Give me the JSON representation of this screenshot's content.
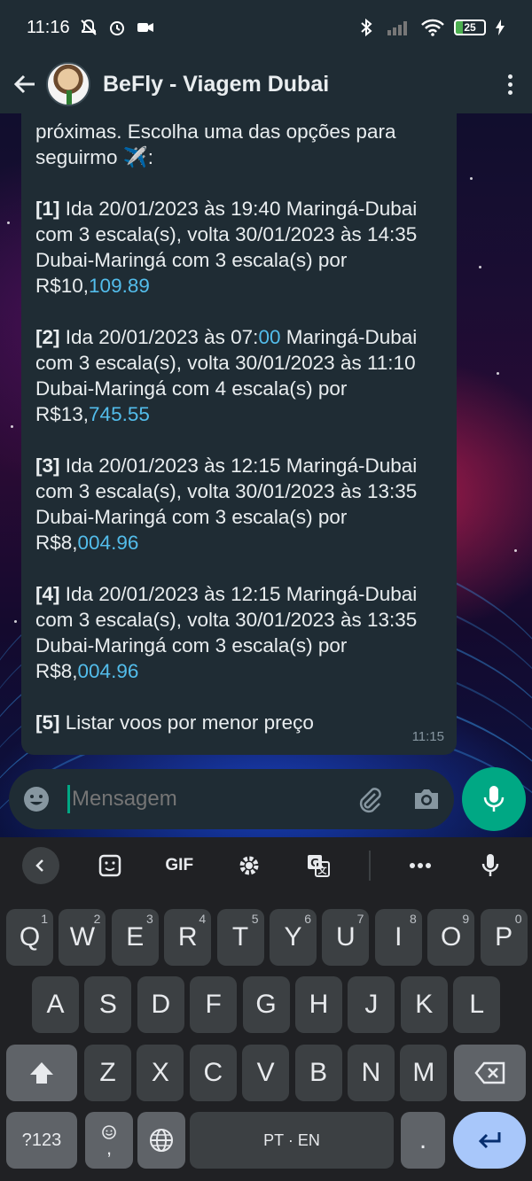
{
  "status_bar": {
    "time": "11:16",
    "battery": "25"
  },
  "header": {
    "title": "BeFly - Viagem Dubai"
  },
  "message": {
    "intro_line1": "próximas. Escolha uma das opções para",
    "intro_line2": "seguirmo ✈️:",
    "options": [
      {
        "num": "[1]",
        "text": " Ida 20/01/2023 às 19:40 Maringá-Dubai com 3 escala(s), volta 30/01/2023 às 14:35 Dubai-Maringá com 3 escala(s) por R$10,",
        "tail": "109.89"
      },
      {
        "num": "[2]",
        "text": " Ida 20/01/2023 às 07:",
        "time_tail": "00",
        "text2": " Maringá-Dubai com 3 escala(s), volta 30/01/2023 às 11:10 Dubai-Maringá com 4 escala(s) por R$13,",
        "tail": "745.55"
      },
      {
        "num": "[3]",
        "text": " Ida 20/01/2023 às 12:15 Maringá-Dubai com 3 escala(s), volta 30/01/2023 às 13:35 Dubai-Maringá com 3 escala(s) por R$8,",
        "tail": "004.96"
      },
      {
        "num": "[4]",
        "text": " Ida 20/01/2023 às 12:15 Maringá-Dubai com 3 escala(s), volta 30/01/2023 às 13:35 Dubai-Maringá com 3 escala(s) por R$8,",
        "tail": "004.96"
      },
      {
        "num": "[5]",
        "text": " Listar voos por menor preço",
        "tail": ""
      }
    ],
    "time": "11:15"
  },
  "compose": {
    "placeholder": "Mensagem"
  },
  "keyboard": {
    "toolbar": {
      "gif": "GIF"
    },
    "row1": [
      {
        "k": "Q",
        "h": "1"
      },
      {
        "k": "W",
        "h": "2"
      },
      {
        "k": "E",
        "h": "3"
      },
      {
        "k": "R",
        "h": "4"
      },
      {
        "k": "T",
        "h": "5"
      },
      {
        "k": "Y",
        "h": "6"
      },
      {
        "k": "U",
        "h": "7"
      },
      {
        "k": "I",
        "h": "8"
      },
      {
        "k": "O",
        "h": "9"
      },
      {
        "k": "P",
        "h": "0"
      }
    ],
    "row2": [
      "A",
      "S",
      "D",
      "F",
      "G",
      "H",
      "J",
      "K",
      "L"
    ],
    "row3": [
      "Z",
      "X",
      "C",
      "V",
      "B",
      "N",
      "M"
    ],
    "symbols_key": "?123",
    "comma_key": ",",
    "space_label": "PT · EN",
    "period_key": "."
  },
  "colors": {
    "accent": "#00a884",
    "link": "#53bdeb",
    "bubble": "#1f2c34",
    "enter_key": "#a8c7fa"
  }
}
